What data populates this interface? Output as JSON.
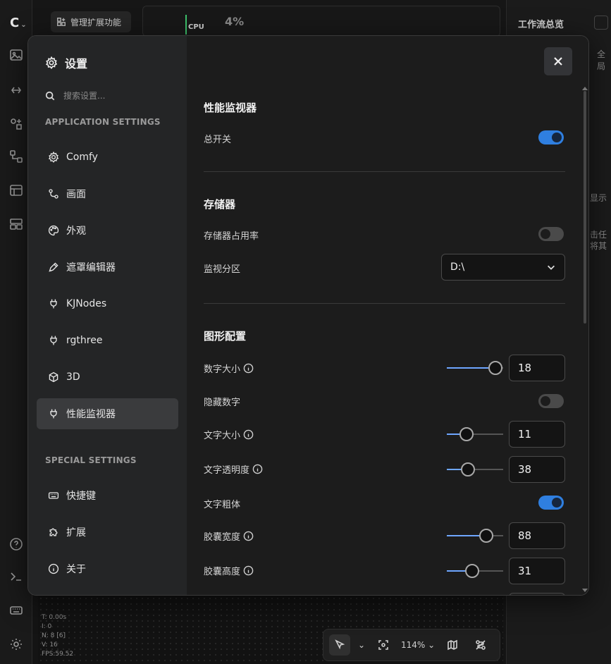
{
  "background": {
    "top_button_label": "管理扩展功能",
    "cpu_label": "CPU",
    "cpu_value": "4%",
    "right_panel_title": "工作流总览",
    "right_panel_partial": [
      "全局",
      "显示",
      "击任",
      "将其"
    ],
    "stats": [
      "T: 0.00s",
      "I: 0",
      "N: 8 [6]",
      "V: 16",
      "FPS:59.52"
    ],
    "zoom": "114%"
  },
  "dialog": {
    "title": "设置",
    "search_placeholder": "搜索设置...",
    "sections": {
      "application": "APPLICATION SETTINGS",
      "special": "SPECIAL SETTINGS"
    },
    "nav_items": [
      {
        "label": "Comfy",
        "icon": "gear-icon"
      },
      {
        "label": "画面",
        "icon": "nodes-icon"
      },
      {
        "label": "外观",
        "icon": "palette-icon"
      },
      {
        "label": "遮罩编辑器",
        "icon": "pen-icon"
      },
      {
        "label": "KJNodes",
        "icon": "plug-icon"
      },
      {
        "label": "rgthree",
        "icon": "plug-icon"
      },
      {
        "label": "3D",
        "icon": "cube-icon"
      },
      {
        "label": "性能监视器",
        "icon": "plug-icon",
        "active": true
      }
    ],
    "special_items": [
      {
        "label": "快捷键",
        "icon": "keyboard-icon"
      },
      {
        "label": "扩展",
        "icon": "puzzle-icon"
      },
      {
        "label": "关于",
        "icon": "info-icon"
      }
    ],
    "content": {
      "perf": {
        "title": "性能监视器",
        "master_switch": {
          "label": "总开关",
          "on": true
        }
      },
      "storage": {
        "title": "存储器",
        "usage": {
          "label": "存储器占用率",
          "on": false
        },
        "partition": {
          "label": "监视分区",
          "value": "D:\\"
        }
      },
      "graphics": {
        "title": "图形配置",
        "number_size": {
          "label": "数字大小",
          "value": "18",
          "fraction": 0.86
        },
        "hide_numbers": {
          "label": "隐藏数字",
          "on": false
        },
        "text_size": {
          "label": "文字大小",
          "value": "11",
          "fraction": 0.35
        },
        "text_opacity": {
          "label": "文字透明度",
          "value": "38",
          "fraction": 0.38
        },
        "text_bold": {
          "label": "文字粗体",
          "on": true
        },
        "capsule_width": {
          "label": "胶囊宽度",
          "value": "88",
          "fraction": 0.7
        },
        "capsule_height": {
          "label": "胶囊高度",
          "value": "31",
          "fraction": 0.45
        }
      }
    }
  }
}
